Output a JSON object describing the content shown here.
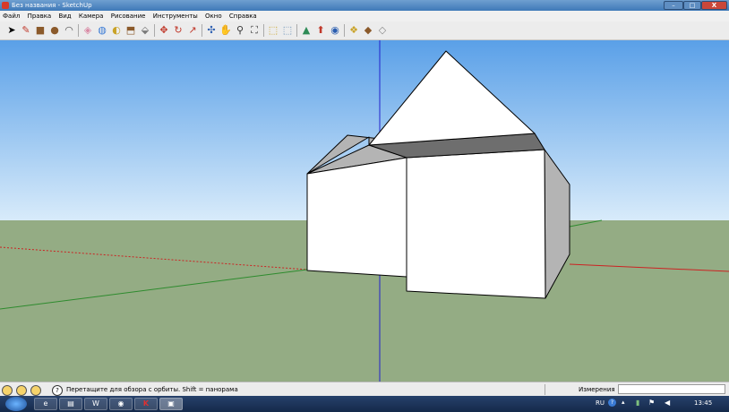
{
  "window": {
    "title": "Без названия - SketchUp",
    "buttons": {
      "minimize": "–",
      "maximize": "□",
      "close": "X"
    }
  },
  "menu": [
    "Файл",
    "Правка",
    "Вид",
    "Камера",
    "Рисование",
    "Инструменты",
    "Окно",
    "Справка"
  ],
  "toolbar": {
    "tools": [
      {
        "name": "select",
        "glyph": "➤",
        "color": "#000000"
      },
      {
        "name": "pencil",
        "glyph": "✎",
        "color": "#c0392b"
      },
      {
        "name": "rectangle",
        "glyph": "■",
        "color": "#8b5a2b"
      },
      {
        "name": "circle",
        "glyph": "●",
        "color": "#8b5a2b"
      },
      {
        "name": "arc",
        "glyph": "◠",
        "color": "#555555"
      },
      {
        "name": "eraser",
        "glyph": "◈",
        "color": "#d98aa5"
      },
      {
        "name": "paint-bucket",
        "glyph": "◍",
        "color": "#3a7bd5"
      },
      {
        "name": "tape-measure",
        "glyph": "◐",
        "color": "#c9a227"
      },
      {
        "name": "push-pull",
        "glyph": "⬒",
        "color": "#8b5a2b"
      },
      {
        "name": "follow-me",
        "glyph": "⬙",
        "color": "#7a7a7a"
      },
      {
        "name": "move",
        "glyph": "✥",
        "color": "#c0392b"
      },
      {
        "name": "rotate",
        "glyph": "↻",
        "color": "#c0392b"
      },
      {
        "name": "offset",
        "glyph": "↗",
        "color": "#c0392b"
      },
      {
        "name": "orbit",
        "glyph": "✣",
        "color": "#2a5db0"
      },
      {
        "name": "pan",
        "glyph": "✋",
        "color": "#555555"
      },
      {
        "name": "zoom",
        "glyph": "⚲",
        "color": "#333333"
      },
      {
        "name": "zoom-extents",
        "glyph": "⛶",
        "color": "#333333"
      },
      {
        "name": "previous-view",
        "glyph": "⬚",
        "color": "#c9a227"
      },
      {
        "name": "next-view",
        "glyph": "⬚",
        "color": "#6a8fb5"
      },
      {
        "name": "get-models",
        "glyph": "▲",
        "color": "#2e8b57"
      },
      {
        "name": "share-model",
        "glyph": "⬆",
        "color": "#c0392b"
      },
      {
        "name": "google-earth",
        "glyph": "◉",
        "color": "#2a5db0"
      },
      {
        "name": "components",
        "glyph": "❖",
        "color": "#c9a227"
      },
      {
        "name": "materials",
        "glyph": "◆",
        "color": "#8b5a2b"
      },
      {
        "name": "styles",
        "glyph": "◇",
        "color": "#888888"
      }
    ]
  },
  "colors": {
    "sky_top": "#5aa0e8",
    "sky_bottom": "#d8ebfa",
    "ground": "#94ac84",
    "axis_red": "#cc2222",
    "axis_green": "#2e8b2e",
    "axis_blue": "#2222cc",
    "face_white": "#ffffff",
    "face_gray": "#b4b4b4",
    "face_dark": "#6e6e6e"
  },
  "status": {
    "hint": "Перетащите для обзора с орбиты.  Shift = панорама",
    "measurements_label": "Измерения",
    "measurements_value": ""
  },
  "taskbar": {
    "language": "RU",
    "time": "13:45"
  }
}
